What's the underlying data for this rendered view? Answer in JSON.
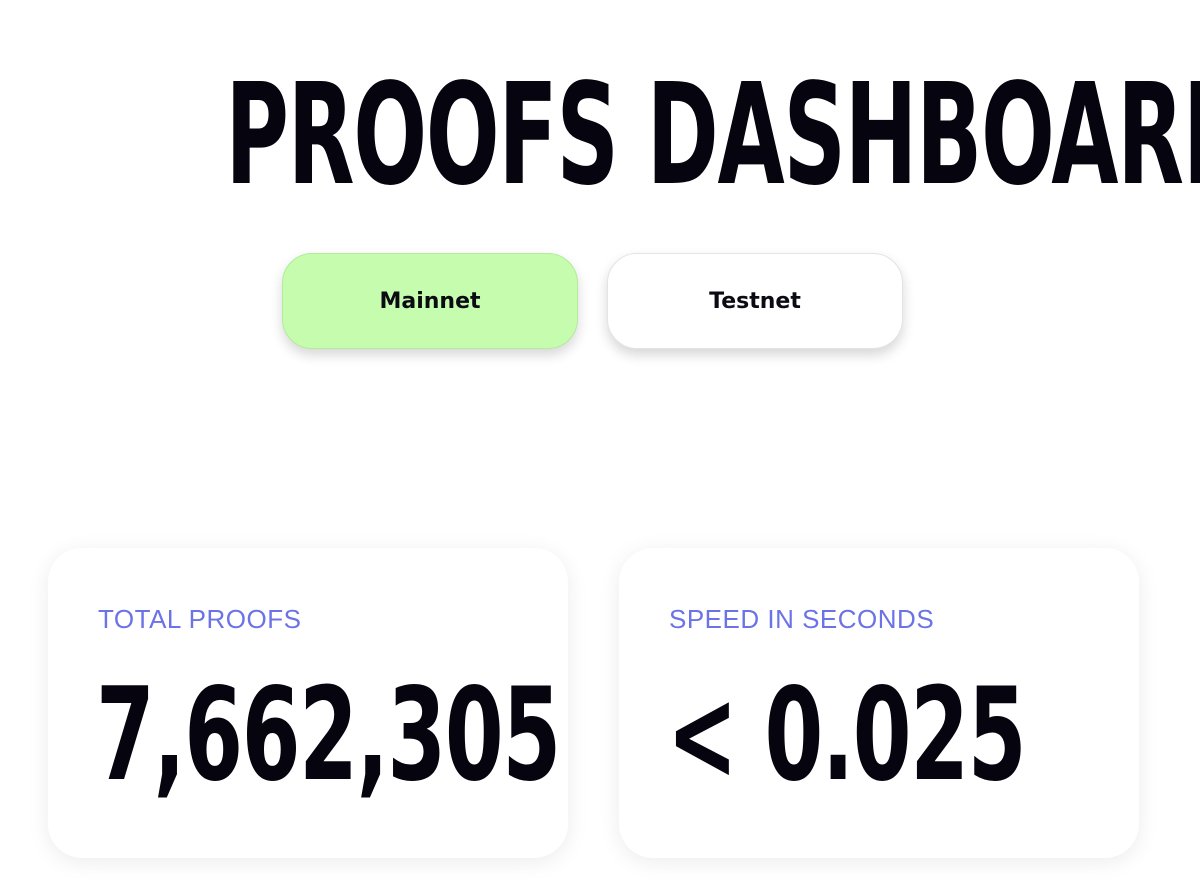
{
  "header": {
    "title": "PROOFS DASHBOARD"
  },
  "network_tabs": [
    {
      "label": "Mainnet",
      "selected": true
    },
    {
      "label": "Testnet",
      "selected": false
    }
  ],
  "stats": {
    "total_proofs": {
      "label": "TOTAL PROOFS",
      "value": "7,662,305"
    },
    "speed": {
      "label": "SPEED IN SECONDS",
      "value": "< 0.025"
    }
  },
  "colors": {
    "active_tab": "#c5fcae",
    "label_accent": "#6b73e6",
    "text_dark": "#05040f"
  }
}
